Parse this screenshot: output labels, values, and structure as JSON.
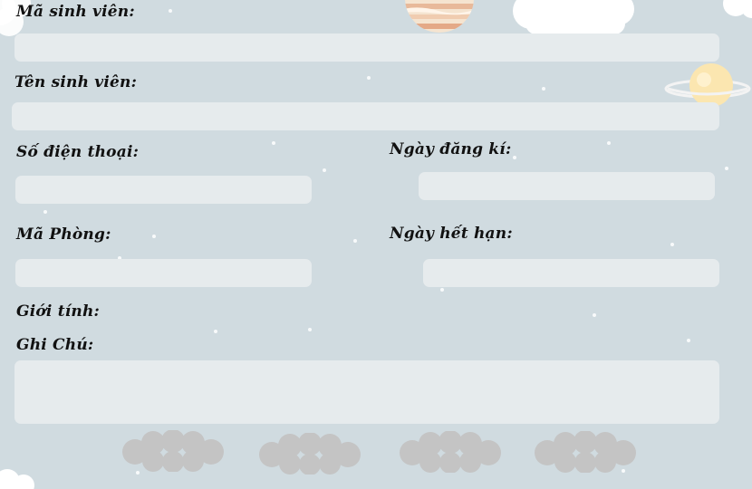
{
  "form": {
    "student_id_label": "Mã sinh viên:",
    "student_id_value": "",
    "student_name_label": "Tên sinh viên:",
    "student_name_value": "",
    "phone_label": "Số điện thoại:",
    "phone_value": "",
    "register_date_label": "Ngày đăng kí:",
    "register_date_value": "",
    "room_label": "Mã Phòng:",
    "room_value": "",
    "expiry_date_label": "Ngày hết hạn:",
    "expiry_date_value": "",
    "gender_label": "Giới tính:",
    "note_label": "Ghi Chú:",
    "note_value": ""
  },
  "buttons": [
    {
      "label": ""
    },
    {
      "label": ""
    },
    {
      "label": ""
    },
    {
      "label": ""
    }
  ],
  "colors": {
    "background": "#d0dbe0",
    "field": "#e6ebed",
    "cloud_button": "#c4c4c4",
    "label_text": "#111111"
  }
}
